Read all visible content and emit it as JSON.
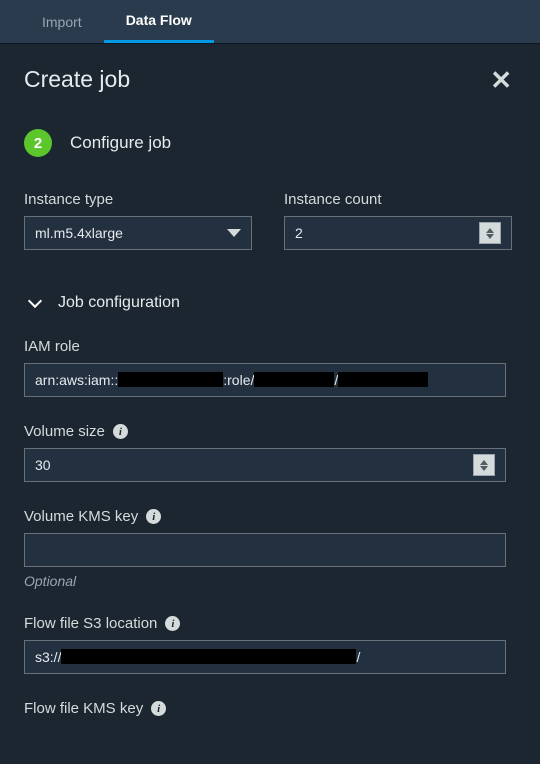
{
  "tabs": {
    "import": "Import",
    "dataFlow": "Data Flow"
  },
  "page": {
    "title": "Create job"
  },
  "step": {
    "number": "2",
    "title": "Configure job"
  },
  "instance": {
    "typeLabel": "Instance type",
    "typeValue": "ml.m5.4xlarge",
    "countLabel": "Instance count",
    "countValue": "2"
  },
  "section": {
    "jobConfig": "Job configuration"
  },
  "iam": {
    "label": "IAM role",
    "prefix": "arn:aws:iam::",
    "mid": ":role/",
    "sep": "/"
  },
  "volume": {
    "sizeLabel": "Volume size",
    "sizeValue": "30",
    "kmsLabel": "Volume KMS key",
    "kmsValue": "",
    "optional": "Optional"
  },
  "flowS3": {
    "label": "Flow file S3 location",
    "prefix": "s3://",
    "suffix": "/"
  },
  "flowKms": {
    "label": "Flow file KMS key"
  }
}
